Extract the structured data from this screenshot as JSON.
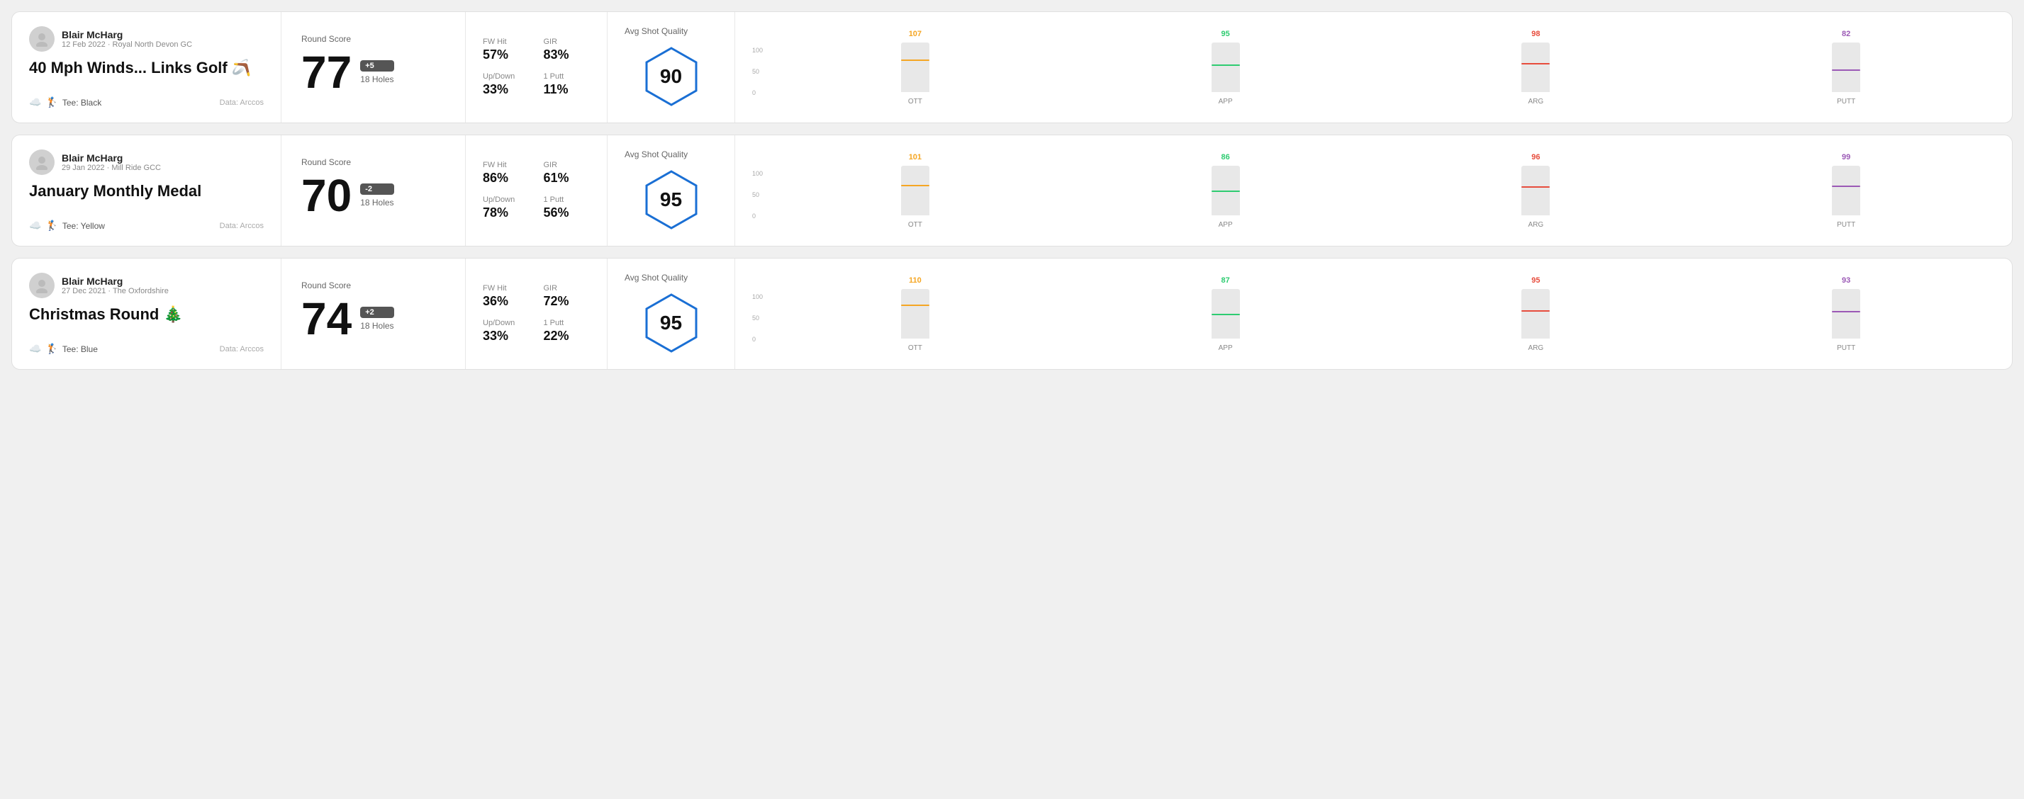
{
  "rounds": [
    {
      "id": "round-1",
      "player": {
        "name": "Blair McHarg",
        "date": "12 Feb 2022 · Royal North Devon GC",
        "tee": "Black",
        "data_source": "Data: Arccos"
      },
      "title": "40 Mph Winds... Links Golf 🪃",
      "score": "77",
      "score_badge": "+5",
      "holes": "18 Holes",
      "stats": {
        "fw_hit_label": "FW Hit",
        "fw_hit_value": "57%",
        "gir_label": "GIR",
        "gir_value": "83%",
        "updown_label": "Up/Down",
        "updown_value": "33%",
        "putt_label": "1 Putt",
        "putt_value": "11%"
      },
      "avg_shot_quality": "90",
      "chart": {
        "bars": [
          {
            "label": "OTT",
            "value": 107,
            "color": "#f5a623",
            "bar_pct": 65
          },
          {
            "label": "APP",
            "value": 95,
            "color": "#2ecc71",
            "bar_pct": 55
          },
          {
            "label": "ARG",
            "value": 98,
            "color": "#e74c3c",
            "bar_pct": 58
          },
          {
            "label": "PUTT",
            "value": 82,
            "color": "#9b59b6",
            "bar_pct": 45
          }
        ]
      }
    },
    {
      "id": "round-2",
      "player": {
        "name": "Blair McHarg",
        "date": "29 Jan 2022 · Mill Ride GCC",
        "tee": "Yellow",
        "data_source": "Data: Arccos"
      },
      "title": "January Monthly Medal",
      "score": "70",
      "score_badge": "-2",
      "holes": "18 Holes",
      "stats": {
        "fw_hit_label": "FW Hit",
        "fw_hit_value": "86%",
        "gir_label": "GIR",
        "gir_value": "61%",
        "updown_label": "Up/Down",
        "updown_value": "78%",
        "putt_label": "1 Putt",
        "putt_value": "56%"
      },
      "avg_shot_quality": "95",
      "chart": {
        "bars": [
          {
            "label": "OTT",
            "value": 101,
            "color": "#f5a623",
            "bar_pct": 62
          },
          {
            "label": "APP",
            "value": 86,
            "color": "#2ecc71",
            "bar_pct": 50
          },
          {
            "label": "ARG",
            "value": 96,
            "color": "#e74c3c",
            "bar_pct": 58
          },
          {
            "label": "PUTT",
            "value": 99,
            "color": "#9b59b6",
            "bar_pct": 60
          }
        ]
      }
    },
    {
      "id": "round-3",
      "player": {
        "name": "Blair McHarg",
        "date": "27 Dec 2021 · The Oxfordshire",
        "tee": "Blue",
        "data_source": "Data: Arccos"
      },
      "title": "Christmas Round 🎄",
      "score": "74",
      "score_badge": "+2",
      "holes": "18 Holes",
      "stats": {
        "fw_hit_label": "FW Hit",
        "fw_hit_value": "36%",
        "gir_label": "GIR",
        "gir_value": "72%",
        "updown_label": "Up/Down",
        "updown_value": "33%",
        "putt_label": "1 Putt",
        "putt_value": "22%"
      },
      "avg_shot_quality": "95",
      "chart": {
        "bars": [
          {
            "label": "OTT",
            "value": 110,
            "color": "#f5a623",
            "bar_pct": 68
          },
          {
            "label": "APP",
            "value": 87,
            "color": "#2ecc71",
            "bar_pct": 50
          },
          {
            "label": "ARG",
            "value": 95,
            "color": "#e74c3c",
            "bar_pct": 57
          },
          {
            "label": "PUTT",
            "value": 93,
            "color": "#9b59b6",
            "bar_pct": 56
          }
        ]
      }
    }
  ],
  "labels": {
    "round_score": "Round Score",
    "avg_shot_quality": "Avg Shot Quality",
    "tee_prefix": "Tee:",
    "data_prefix": "Data: Arccos",
    "axis_100": "100",
    "axis_50": "50",
    "axis_0": "0"
  }
}
